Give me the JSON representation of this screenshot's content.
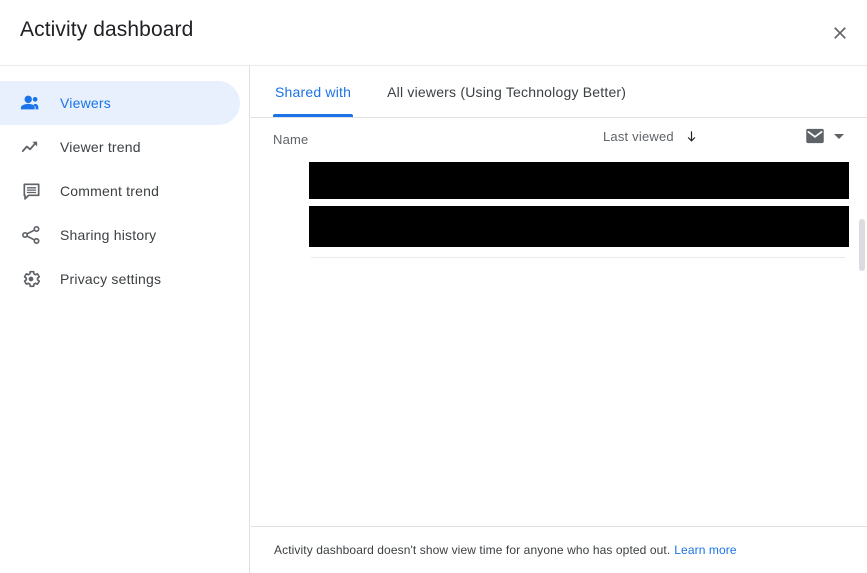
{
  "header": {
    "title": "Activity dashboard",
    "close_label": "Close"
  },
  "sidebar": {
    "items": [
      {
        "label": "Viewers",
        "icon": "people-icon",
        "active": true
      },
      {
        "label": "Viewer trend",
        "icon": "trending-up-icon",
        "active": false
      },
      {
        "label": "Comment trend",
        "icon": "comment-icon",
        "active": false
      },
      {
        "label": "Sharing history",
        "icon": "share-icon",
        "active": false
      },
      {
        "label": "Privacy settings",
        "icon": "gear-icon",
        "active": false
      }
    ]
  },
  "main": {
    "tabs": [
      {
        "label": "Shared with",
        "selected": true
      },
      {
        "label": "All viewers (Using Technology Better)",
        "selected": false
      }
    ],
    "table": {
      "columns": {
        "name": "Name",
        "last_viewed": "Last viewed",
        "sort_direction_icon": "arrow-down-icon",
        "email_icon": "mail-icon",
        "email_menu_icon": "chevron-down-icon"
      },
      "rows": [
        {
          "name": "",
          "last_viewed": "",
          "redacted": true
        },
        {
          "name": "",
          "last_viewed": "",
          "redacted": true
        }
      ]
    },
    "footer": {
      "text": "Activity dashboard doesn't show view time for anyone who has opted out.",
      "link_label": "Learn more"
    }
  },
  "colors": {
    "accent": "#1a73e8",
    "accent_bg": "#e8f0fe",
    "text": "#202124",
    "muted": "#5f6368",
    "divider": "#e0e0e0",
    "redaction": "#000000"
  }
}
